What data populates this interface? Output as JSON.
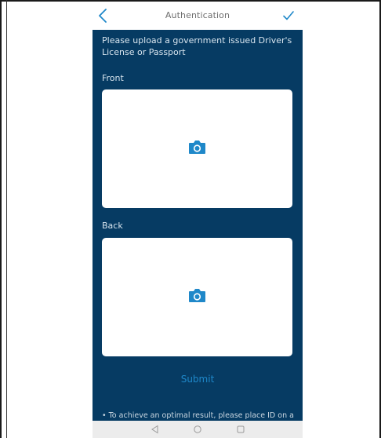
{
  "header": {
    "title": "Authentication",
    "back_icon": "chevron-left-icon",
    "confirm_icon": "check-icon"
  },
  "instructions": "Please upload a government issued Driver's License or Passport",
  "front": {
    "label": "Front",
    "icon": "camera-icon"
  },
  "back": {
    "label": "Back",
    "icon": "camera-icon"
  },
  "submit_label": "Submit",
  "footnote": "• To achieve an optimal result, please place ID on a",
  "nav": {
    "back_icon": "triangle-back-icon",
    "home_icon": "circle-home-icon",
    "recent_icon": "square-recent-icon"
  },
  "colors": {
    "content_background": "#063b63",
    "accent": "#1f88c9",
    "text_light": "#d7e4ee",
    "header_title": "#6f6f6f"
  }
}
